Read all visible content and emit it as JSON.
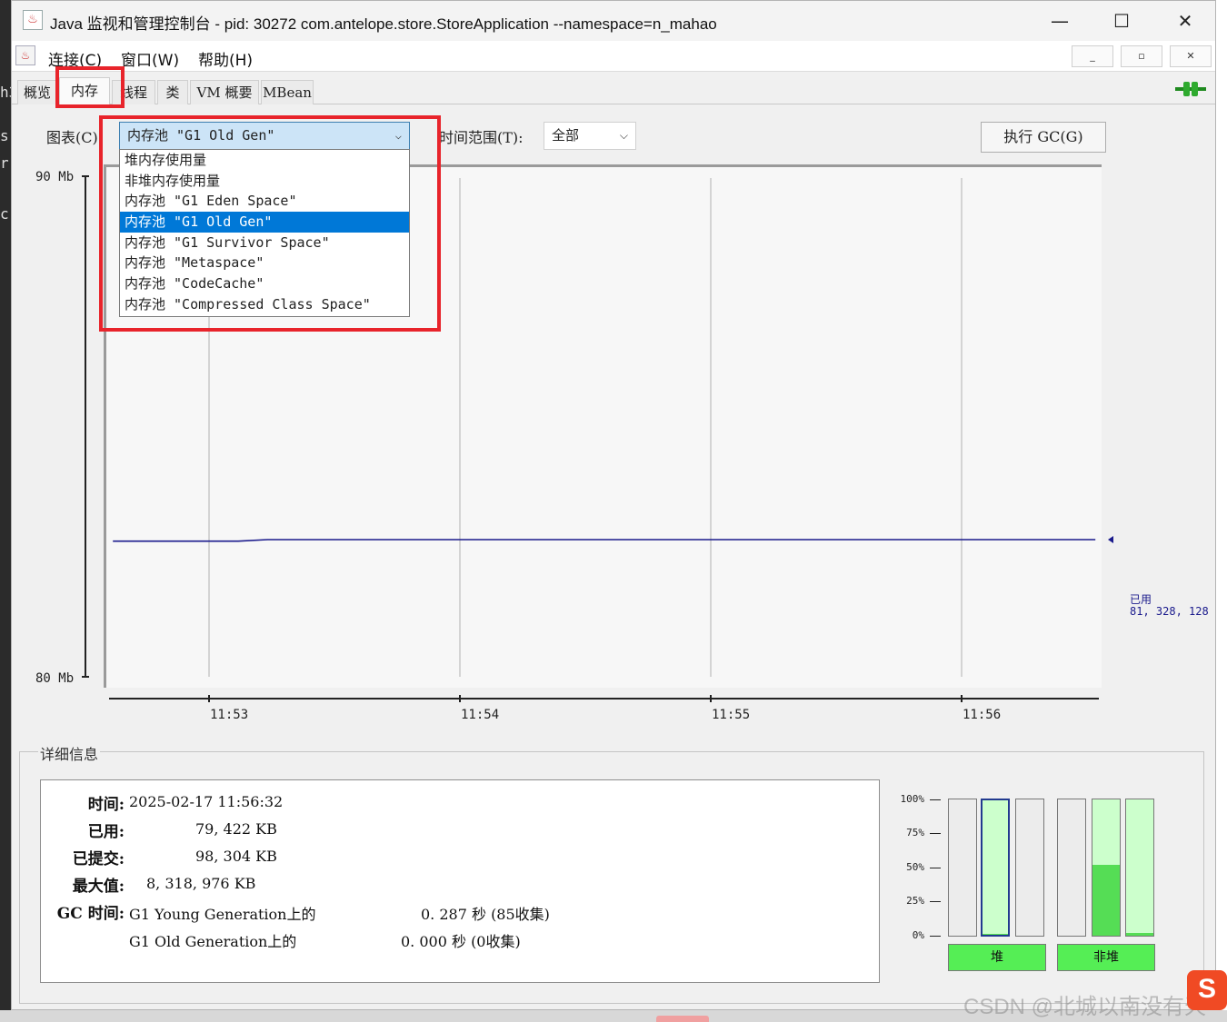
{
  "background": {
    "left_chars": [
      "h3",
      "s",
      "r",
      "c"
    ]
  },
  "window": {
    "title": "Java 监视和管理控制台 - pid: 30272 com.antelope.store.StoreApplication --namespace=n_mahao",
    "controls": {
      "minimize": "—",
      "maximize": "☐",
      "close": "✕"
    }
  },
  "menu": {
    "items": [
      "连接(C)",
      "窗口(W)",
      "帮助(H)"
    ],
    "inner_controls": {
      "minimize": "_",
      "restore": "▫",
      "close": "✕"
    }
  },
  "tabs": [
    "概览",
    "内存",
    "线程",
    "类",
    "VM 概要",
    "MBean"
  ],
  "active_tab": "内存",
  "controls": {
    "chart_label": "图表(C):",
    "chart_selected": "内存池 \"G1 Old Gen\"",
    "time_range_label": "时间范围(T):",
    "time_range_value": "全部",
    "gc_button": "执行 GC(G)"
  },
  "dropdown": {
    "options": [
      "堆内存使用量",
      "非堆内存使用量",
      "内存池 \"G1 Eden Space\"",
      "内存池 \"G1 Old Gen\"",
      "内存池 \"G1 Survivor Space\"",
      "内存池 \"Metaspace\"",
      "内存池 \"CodeCache\"",
      "内存池 \"Compressed Class Space\""
    ],
    "selected_index": 3
  },
  "chart_data": {
    "type": "line",
    "ylim": [
      80,
      90
    ],
    "y_unit": "Mb",
    "y_ticks": [
      "90 Mb",
      "80 Mb"
    ],
    "x_ticks": [
      "11:53",
      "11:54",
      "11:55",
      "11:56"
    ],
    "series": [
      {
        "name": "已用",
        "color": "#1a1a8c",
        "x": [
          "11:52:37",
          "11:53:07",
          "11:53:14",
          "11:56:32"
        ],
        "values": [
          82.72,
          82.72,
          82.75,
          82.75
        ]
      }
    ],
    "current_label": "已用",
    "current_value": "81, 328, 128",
    "grid": true
  },
  "details": {
    "legend": "详细信息",
    "time_label": "时间:",
    "time_value": "2025-02-17 11:56:32",
    "used_label": "已用:",
    "used_value": "79, 422 KB",
    "committed_label": "已提交:",
    "committed_value": "98, 304 KB",
    "max_label": "最大值:",
    "max_value": "8, 318, 976 KB",
    "gc_label": "GC 时间:",
    "gc_young_name": "G1 Young Generation上的",
    "gc_young_value": "0. 287  秒 (85收集)",
    "gc_old_name": "G1 Old Generation上的",
    "gc_old_value": "0. 000  秒 (0收集)"
  },
  "usage_bars": {
    "percent_labels": [
      "100%",
      "75%",
      "50%",
      "25%",
      "0%"
    ],
    "heap_label": "堆",
    "nonheap_label": "非堆",
    "heap_fill": [
      0.0,
      0.01,
      0.0
    ],
    "nonheap_fill": [
      0.0,
      0.52,
      0.02
    ],
    "selected_bar": "heap-2"
  },
  "watermark": "CSDN @北城以南没有天",
  "watermark_logo": "S",
  "colors": {
    "highlight": "#e8242b",
    "selection": "#0078d7",
    "bar_fill": "#55dd55",
    "line": "#1a1a8c"
  }
}
